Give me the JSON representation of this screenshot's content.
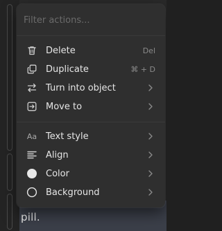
{
  "search": {
    "placeholder": "Filter actions..."
  },
  "menu": {
    "group1": [
      {
        "label": "Delete",
        "shortcut": "Del",
        "icon": "trash-icon"
      },
      {
        "label": "Duplicate",
        "shortcut": "⌘ + D",
        "icon": "duplicate-icon"
      },
      {
        "label": "Turn into object",
        "icon": "swap-arrows-icon",
        "submenu": true
      },
      {
        "label": "Move to",
        "icon": "move-to-icon",
        "submenu": true
      }
    ],
    "group2": [
      {
        "label": "Text style",
        "icon": "text-style-icon",
        "icon_text": "Aa",
        "submenu": true
      },
      {
        "label": "Align",
        "icon": "align-left-icon",
        "submenu": true
      },
      {
        "label": "Color",
        "icon": "color-dot-icon",
        "submenu": true
      },
      {
        "label": "Background",
        "icon": "background-circle-icon",
        "submenu": true
      }
    ]
  },
  "background_page": {
    "visible_text": "pill."
  },
  "colors": {
    "menu_bg": "#2f2f2f",
    "text": "#e6e6e6",
    "muted": "#8a8a8a",
    "highlight_row": "#3b3f49"
  }
}
